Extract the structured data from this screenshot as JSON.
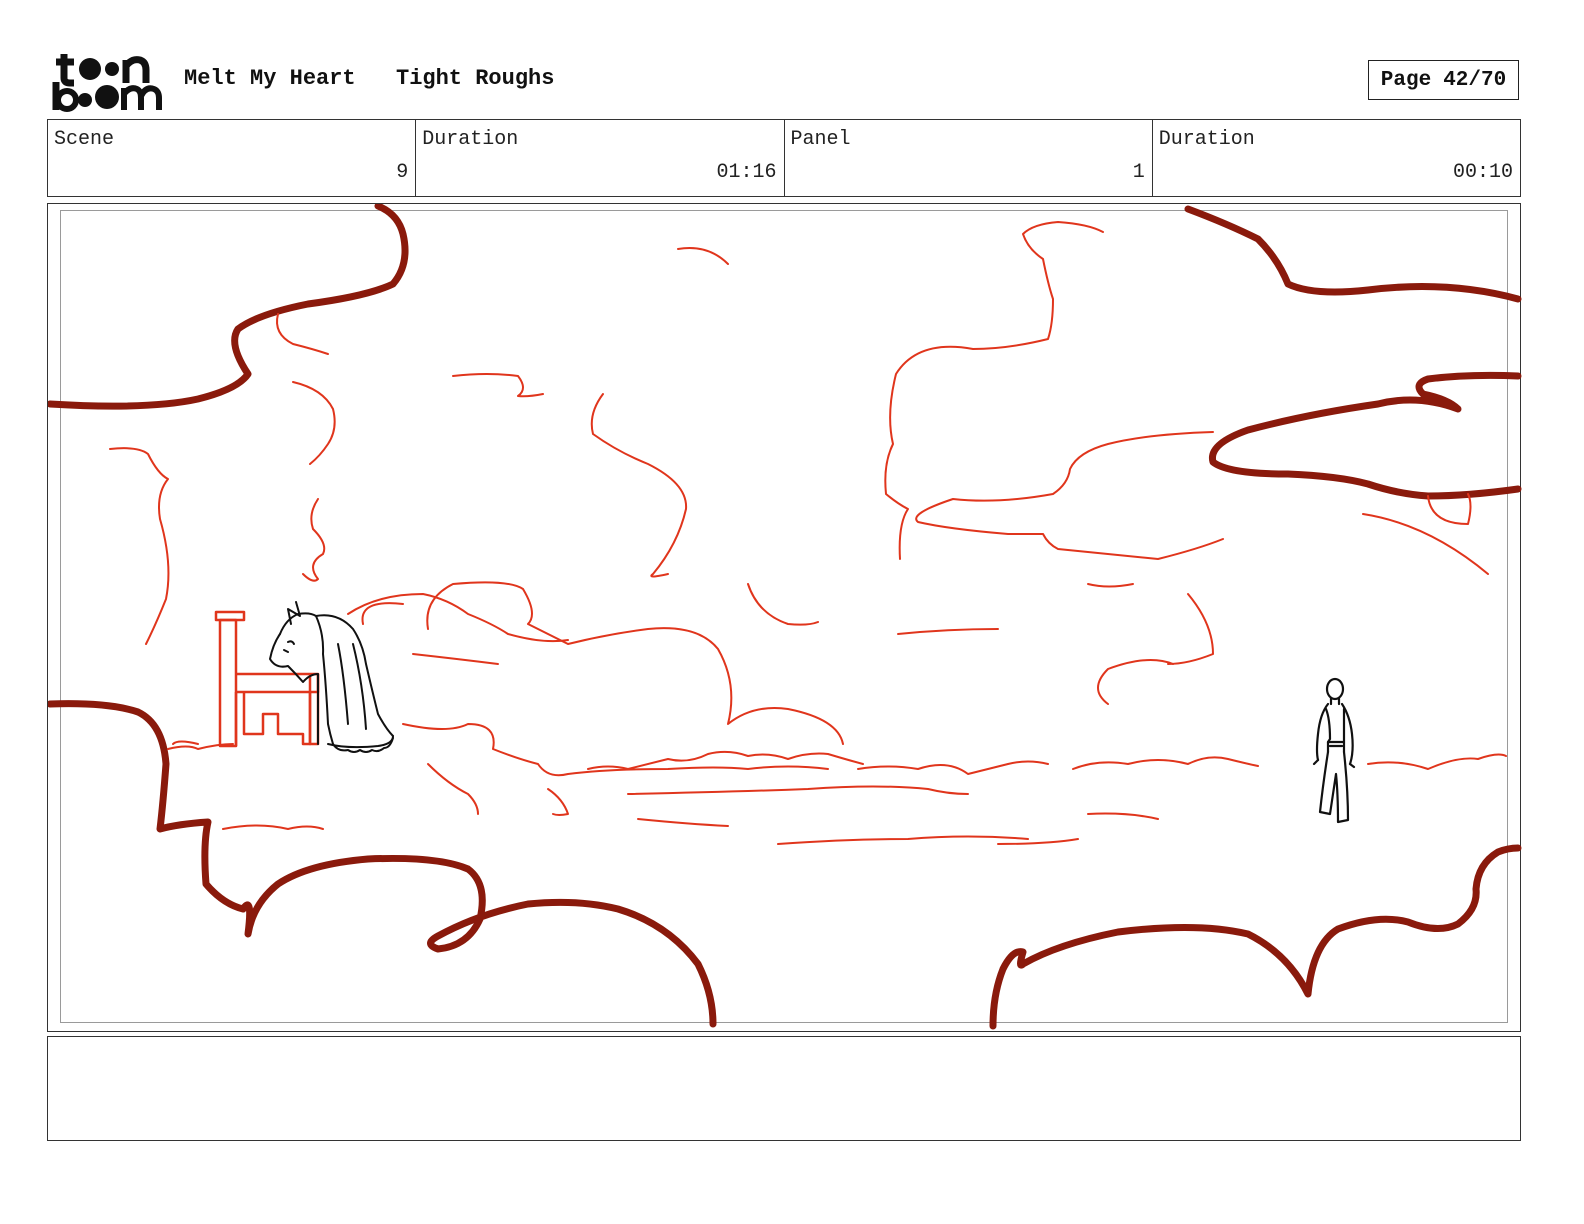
{
  "header": {
    "logo_top": "t••n",
    "logo_bottom": "b••m",
    "project_title": "Melt My Heart",
    "subtitle": "Tight Roughs",
    "page_label": "Page",
    "page_number": "42/70"
  },
  "info": {
    "scene_label": "Scene",
    "scene_value": "9",
    "scene_duration_label": "Duration",
    "scene_duration_value": "01:16",
    "panel_label": "Panel",
    "panel_value": "1",
    "panel_duration_label": "Duration",
    "panel_duration_value": "00:10"
  },
  "colors": {
    "cloud_outline": "#8a1a0c",
    "cloud_sketch": "#e0351c",
    "figure_ink": "#111111"
  },
  "notes": {
    "text": ""
  }
}
